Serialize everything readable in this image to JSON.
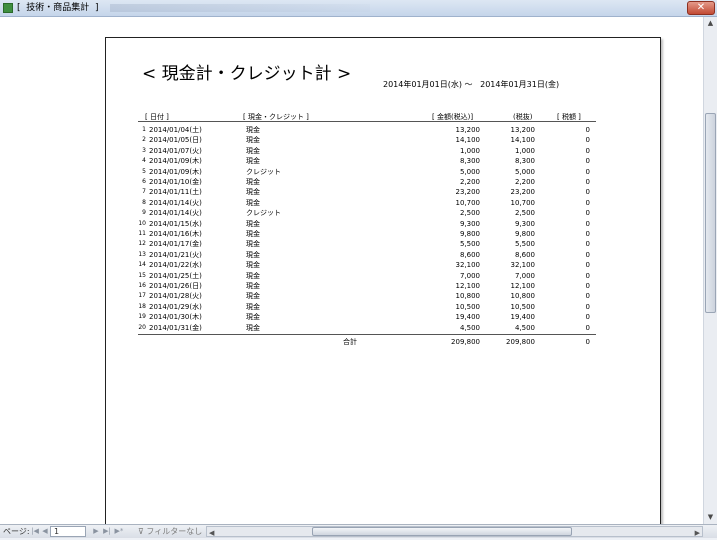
{
  "window": {
    "title": "[  技術・商品集計  ]",
    "close_glyph": "✕"
  },
  "report": {
    "title": "< 現金計・クレジット計 >",
    "date_range": "2014年01月01日(水) ～   2014年01月31日(金)",
    "headers": {
      "date": "[ 日付 ]",
      "type": "[ 現金・クレジット ]",
      "incl": "[ 金額(税込)]",
      "excl": "(税抜)",
      "tax": "[ 税額 ]"
    },
    "rows": [
      {
        "no": "1",
        "date": "2014/01/04(土)",
        "type": "現金",
        "incl": "13,200",
        "excl": "13,200",
        "tax": "0"
      },
      {
        "no": "2",
        "date": "2014/01/05(日)",
        "type": "現金",
        "incl": "14,100",
        "excl": "14,100",
        "tax": "0"
      },
      {
        "no": "3",
        "date": "2014/01/07(火)",
        "type": "現金",
        "incl": "1,000",
        "excl": "1,000",
        "tax": "0"
      },
      {
        "no": "4",
        "date": "2014/01/09(木)",
        "type": "現金",
        "incl": "8,300",
        "excl": "8,300",
        "tax": "0"
      },
      {
        "no": "5",
        "date": "2014/01/09(木)",
        "type": "クレジット",
        "incl": "5,000",
        "excl": "5,000",
        "tax": "0"
      },
      {
        "no": "6",
        "date": "2014/01/10(金)",
        "type": "現金",
        "incl": "2,200",
        "excl": "2,200",
        "tax": "0"
      },
      {
        "no": "7",
        "date": "2014/01/11(土)",
        "type": "現金",
        "incl": "23,200",
        "excl": "23,200",
        "tax": "0"
      },
      {
        "no": "8",
        "date": "2014/01/14(火)",
        "type": "現金",
        "incl": "10,700",
        "excl": "10,700",
        "tax": "0"
      },
      {
        "no": "9",
        "date": "2014/01/14(火)",
        "type": "クレジット",
        "incl": "2,500",
        "excl": "2,500",
        "tax": "0"
      },
      {
        "no": "10",
        "date": "2014/01/15(水)",
        "type": "現金",
        "incl": "9,300",
        "excl": "9,300",
        "tax": "0"
      },
      {
        "no": "11",
        "date": "2014/01/16(木)",
        "type": "現金",
        "incl": "9,800",
        "excl": "9,800",
        "tax": "0"
      },
      {
        "no": "12",
        "date": "2014/01/17(金)",
        "type": "現金",
        "incl": "5,500",
        "excl": "5,500",
        "tax": "0"
      },
      {
        "no": "13",
        "date": "2014/01/21(火)",
        "type": "現金",
        "incl": "8,600",
        "excl": "8,600",
        "tax": "0"
      },
      {
        "no": "14",
        "date": "2014/01/22(水)",
        "type": "現金",
        "incl": "32,100",
        "excl": "32,100",
        "tax": "0"
      },
      {
        "no": "15",
        "date": "2014/01/25(土)",
        "type": "現金",
        "incl": "7,000",
        "excl": "7,000",
        "tax": "0"
      },
      {
        "no": "16",
        "date": "2014/01/26(日)",
        "type": "現金",
        "incl": "12,100",
        "excl": "12,100",
        "tax": "0"
      },
      {
        "no": "17",
        "date": "2014/01/28(火)",
        "type": "現金",
        "incl": "10,800",
        "excl": "10,800",
        "tax": "0"
      },
      {
        "no": "18",
        "date": "2014/01/29(水)",
        "type": "現金",
        "incl": "10,500",
        "excl": "10,500",
        "tax": "0"
      },
      {
        "no": "19",
        "date": "2014/01/30(木)",
        "type": "現金",
        "incl": "19,400",
        "excl": "19,400",
        "tax": "0"
      },
      {
        "no": "20",
        "date": "2014/01/31(金)",
        "type": "現金",
        "incl": "4,500",
        "excl": "4,500",
        "tax": "0"
      }
    ],
    "total": {
      "label": "合計",
      "incl": "209,800",
      "excl": "209,800",
      "tax": "0"
    }
  },
  "statusbar": {
    "page_label": "ページ:",
    "page_value": "1",
    "filter_label": "フィルターなし"
  }
}
